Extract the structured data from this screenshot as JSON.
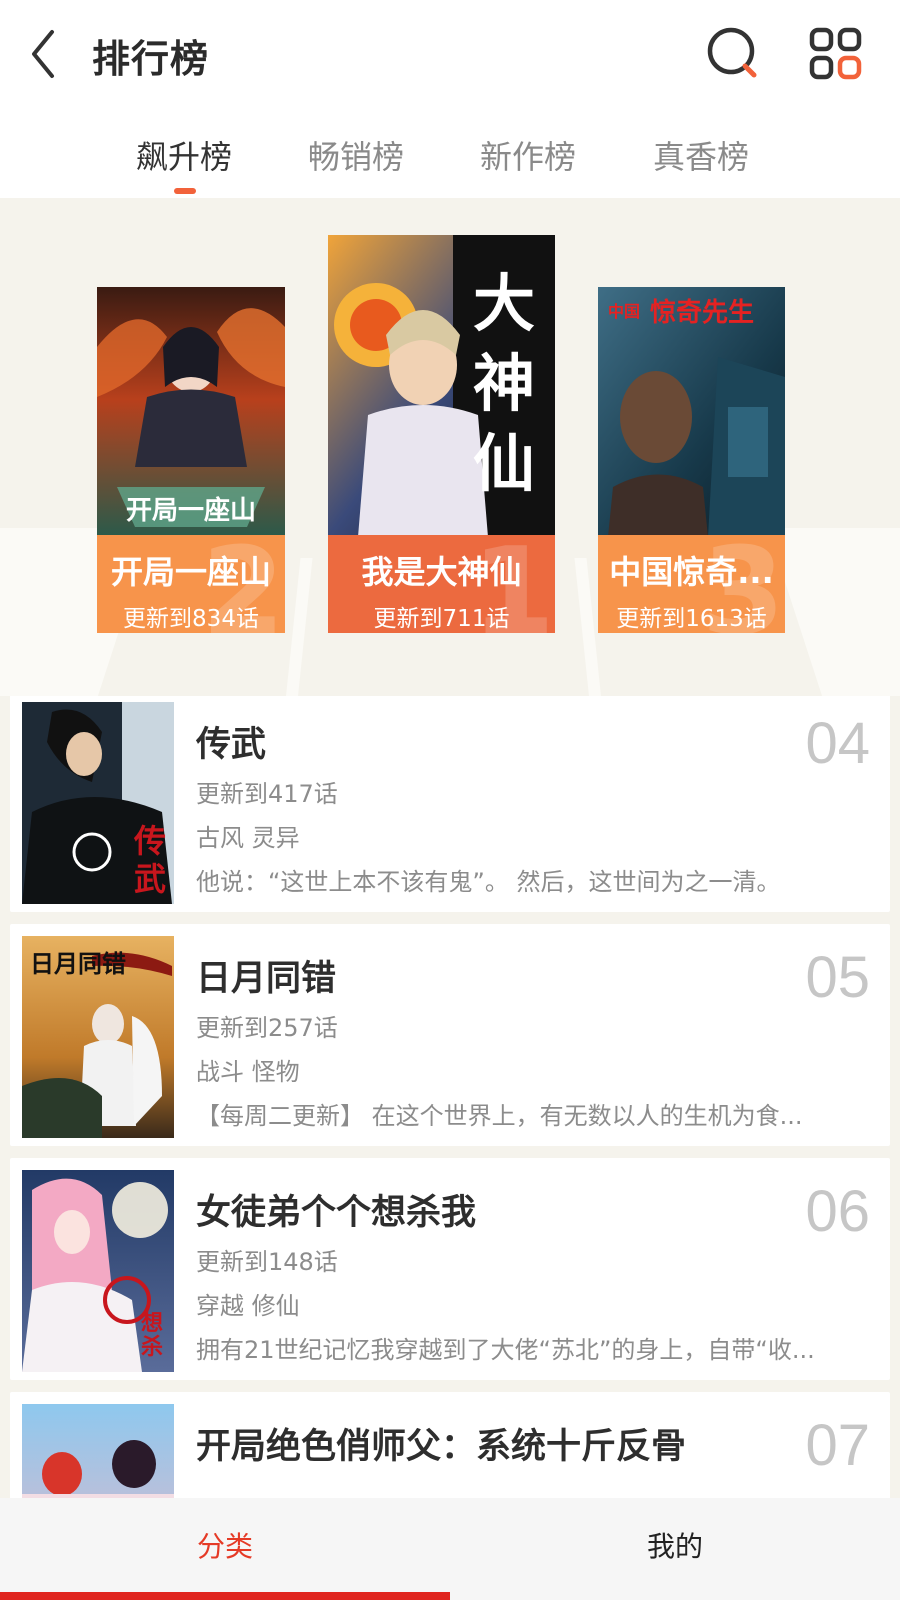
{
  "header": {
    "title": "排行榜"
  },
  "tabs": [
    {
      "label": "飙升榜",
      "active": true
    },
    {
      "label": "畅销榜",
      "active": false
    },
    {
      "label": "新作榜",
      "active": false
    },
    {
      "label": "真香榜",
      "active": false
    }
  ],
  "podium": [
    {
      "rank": "1",
      "name": "我是大神仙",
      "chapter": "更新到711话"
    },
    {
      "rank": "2",
      "name": "开局一座山",
      "chapter": "更新到834话"
    },
    {
      "rank": "3",
      "name": "中国惊奇...",
      "chapter": "更新到1613话"
    }
  ],
  "list": [
    {
      "rank": "04",
      "title": "传武",
      "chapter": "更新到417话",
      "tags": "古风 灵异",
      "desc": "他说：“这世上本不该有鬼”。 然后，这世间为之一清。"
    },
    {
      "rank": "05",
      "title": "日月同错",
      "chapter": "更新到257话",
      "tags": "战斗 怪物",
      "desc": "【每周二更新】 在这个世界上，有无数以人的生机为食..."
    },
    {
      "rank": "06",
      "title": "女徒弟个个想杀我",
      "chapter": "更新到148话",
      "tags": "穿越 修仙",
      "desc": "拥有21世纪记忆我穿越到了大佬“苏北”的身上，自带“收..."
    },
    {
      "rank": "07",
      "title": "开局绝色俏师父：系统十斤反骨",
      "chapter": "",
      "tags": "",
      "desc": ""
    }
  ],
  "bottom_nav": [
    {
      "label": "分类",
      "active": true
    },
    {
      "label": "我的",
      "active": false
    }
  ],
  "colors": {
    "accent": "#f2623a",
    "nav_active": "#e53a26",
    "podium_label": "#f7944b",
    "podium_label_first": "#ec6a3f"
  },
  "icons": [
    "back-arrow-icon",
    "search-icon",
    "apps-grid-icon"
  ]
}
